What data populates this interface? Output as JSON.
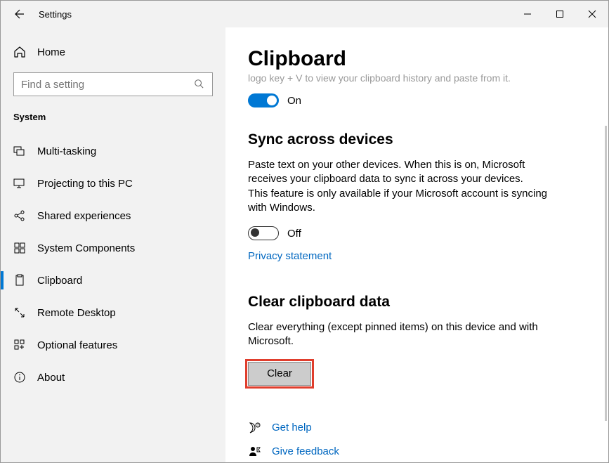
{
  "window": {
    "title": "Settings"
  },
  "sidebar": {
    "home": "Home",
    "search_placeholder": "Find a setting",
    "category": "System",
    "items": [
      {
        "label": "Multi-tasking"
      },
      {
        "label": "Projecting to this PC"
      },
      {
        "label": "Shared experiences"
      },
      {
        "label": "System Components"
      },
      {
        "label": "Clipboard",
        "selected": true
      },
      {
        "label": "Remote Desktop"
      },
      {
        "label": "Optional features"
      },
      {
        "label": "About"
      }
    ]
  },
  "content": {
    "page_title": "Clipboard",
    "truncated_line": "logo key + V to view your clipboard history and paste from it.",
    "history_toggle": {
      "state": "On"
    },
    "sync": {
      "heading": "Sync across devices",
      "text": "Paste text on your other devices. When this is on, Microsoft receives your clipboard data to sync it across your devices.\nThis feature is only available if your Microsoft account is syncing with Windows.",
      "toggle_state": "Off",
      "privacy_link": "Privacy statement"
    },
    "clear": {
      "heading": "Clear clipboard data",
      "text": "Clear everything (except pinned items) on this device and with Microsoft.",
      "button": "Clear"
    },
    "help": {
      "get_help": "Get help",
      "feedback": "Give feedback"
    }
  }
}
